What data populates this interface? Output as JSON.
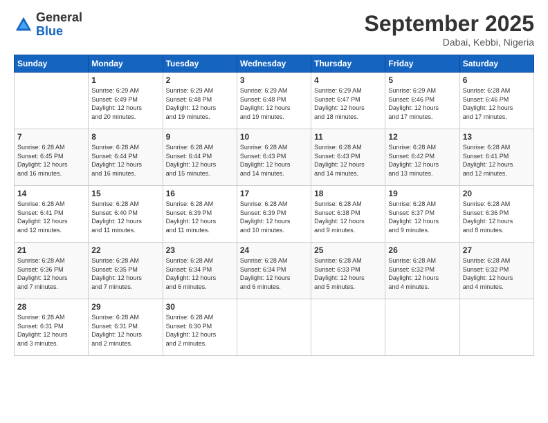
{
  "logo": {
    "general": "General",
    "blue": "Blue"
  },
  "header": {
    "month": "September 2025",
    "location": "Dabai, Kebbi, Nigeria"
  },
  "days_header": [
    "Sunday",
    "Monday",
    "Tuesday",
    "Wednesday",
    "Thursday",
    "Friday",
    "Saturday"
  ],
  "weeks": [
    [
      {
        "num": "",
        "info": ""
      },
      {
        "num": "1",
        "info": "Sunrise: 6:29 AM\nSunset: 6:49 PM\nDaylight: 12 hours\nand 20 minutes."
      },
      {
        "num": "2",
        "info": "Sunrise: 6:29 AM\nSunset: 6:48 PM\nDaylight: 12 hours\nand 19 minutes."
      },
      {
        "num": "3",
        "info": "Sunrise: 6:29 AM\nSunset: 6:48 PM\nDaylight: 12 hours\nand 19 minutes."
      },
      {
        "num": "4",
        "info": "Sunrise: 6:29 AM\nSunset: 6:47 PM\nDaylight: 12 hours\nand 18 minutes."
      },
      {
        "num": "5",
        "info": "Sunrise: 6:29 AM\nSunset: 6:46 PM\nDaylight: 12 hours\nand 17 minutes."
      },
      {
        "num": "6",
        "info": "Sunrise: 6:28 AM\nSunset: 6:46 PM\nDaylight: 12 hours\nand 17 minutes."
      }
    ],
    [
      {
        "num": "7",
        "info": "Sunrise: 6:28 AM\nSunset: 6:45 PM\nDaylight: 12 hours\nand 16 minutes."
      },
      {
        "num": "8",
        "info": "Sunrise: 6:28 AM\nSunset: 6:44 PM\nDaylight: 12 hours\nand 16 minutes."
      },
      {
        "num": "9",
        "info": "Sunrise: 6:28 AM\nSunset: 6:44 PM\nDaylight: 12 hours\nand 15 minutes."
      },
      {
        "num": "10",
        "info": "Sunrise: 6:28 AM\nSunset: 6:43 PM\nDaylight: 12 hours\nand 14 minutes."
      },
      {
        "num": "11",
        "info": "Sunrise: 6:28 AM\nSunset: 6:43 PM\nDaylight: 12 hours\nand 14 minutes."
      },
      {
        "num": "12",
        "info": "Sunrise: 6:28 AM\nSunset: 6:42 PM\nDaylight: 12 hours\nand 13 minutes."
      },
      {
        "num": "13",
        "info": "Sunrise: 6:28 AM\nSunset: 6:41 PM\nDaylight: 12 hours\nand 12 minutes."
      }
    ],
    [
      {
        "num": "14",
        "info": "Sunrise: 6:28 AM\nSunset: 6:41 PM\nDaylight: 12 hours\nand 12 minutes."
      },
      {
        "num": "15",
        "info": "Sunrise: 6:28 AM\nSunset: 6:40 PM\nDaylight: 12 hours\nand 11 minutes."
      },
      {
        "num": "16",
        "info": "Sunrise: 6:28 AM\nSunset: 6:39 PM\nDaylight: 12 hours\nand 11 minutes."
      },
      {
        "num": "17",
        "info": "Sunrise: 6:28 AM\nSunset: 6:39 PM\nDaylight: 12 hours\nand 10 minutes."
      },
      {
        "num": "18",
        "info": "Sunrise: 6:28 AM\nSunset: 6:38 PM\nDaylight: 12 hours\nand 9 minutes."
      },
      {
        "num": "19",
        "info": "Sunrise: 6:28 AM\nSunset: 6:37 PM\nDaylight: 12 hours\nand 9 minutes."
      },
      {
        "num": "20",
        "info": "Sunrise: 6:28 AM\nSunset: 6:36 PM\nDaylight: 12 hours\nand 8 minutes."
      }
    ],
    [
      {
        "num": "21",
        "info": "Sunrise: 6:28 AM\nSunset: 6:36 PM\nDaylight: 12 hours\nand 7 minutes."
      },
      {
        "num": "22",
        "info": "Sunrise: 6:28 AM\nSunset: 6:35 PM\nDaylight: 12 hours\nand 7 minutes."
      },
      {
        "num": "23",
        "info": "Sunrise: 6:28 AM\nSunset: 6:34 PM\nDaylight: 12 hours\nand 6 minutes."
      },
      {
        "num": "24",
        "info": "Sunrise: 6:28 AM\nSunset: 6:34 PM\nDaylight: 12 hours\nand 6 minutes."
      },
      {
        "num": "25",
        "info": "Sunrise: 6:28 AM\nSunset: 6:33 PM\nDaylight: 12 hours\nand 5 minutes."
      },
      {
        "num": "26",
        "info": "Sunrise: 6:28 AM\nSunset: 6:32 PM\nDaylight: 12 hours\nand 4 minutes."
      },
      {
        "num": "27",
        "info": "Sunrise: 6:28 AM\nSunset: 6:32 PM\nDaylight: 12 hours\nand 4 minutes."
      }
    ],
    [
      {
        "num": "28",
        "info": "Sunrise: 6:28 AM\nSunset: 6:31 PM\nDaylight: 12 hours\nand 3 minutes."
      },
      {
        "num": "29",
        "info": "Sunrise: 6:28 AM\nSunset: 6:31 PM\nDaylight: 12 hours\nand 2 minutes."
      },
      {
        "num": "30",
        "info": "Sunrise: 6:28 AM\nSunset: 6:30 PM\nDaylight: 12 hours\nand 2 minutes."
      },
      {
        "num": "",
        "info": ""
      },
      {
        "num": "",
        "info": ""
      },
      {
        "num": "",
        "info": ""
      },
      {
        "num": "",
        "info": ""
      }
    ]
  ]
}
